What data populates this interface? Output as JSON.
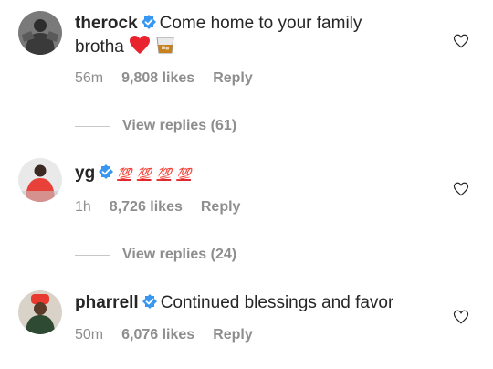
{
  "comments": [
    {
      "username": "therock",
      "text": "Come home to your family",
      "text2": "brotha",
      "emoji": [
        "heart-emoji",
        "tumbler-glass-emoji"
      ],
      "age": "56m",
      "likes": "9,808 likes",
      "reply": "Reply",
      "view_replies": "View replies (61)"
    },
    {
      "username": "yg",
      "text_emoji": [
        "💯",
        "💯",
        "💯",
        "💯"
      ],
      "age": "1h",
      "likes": "8,726 likes",
      "reply": "Reply",
      "view_replies": "View replies (24)"
    },
    {
      "username": "pharrell",
      "text": "Continued blessings and favor",
      "age": "50m",
      "likes": "6,076 likes",
      "reply": "Reply"
    }
  ],
  "colors": {
    "verified": "#3897f0",
    "meta": "#8e8e8e",
    "hundred": "#e0262e"
  }
}
